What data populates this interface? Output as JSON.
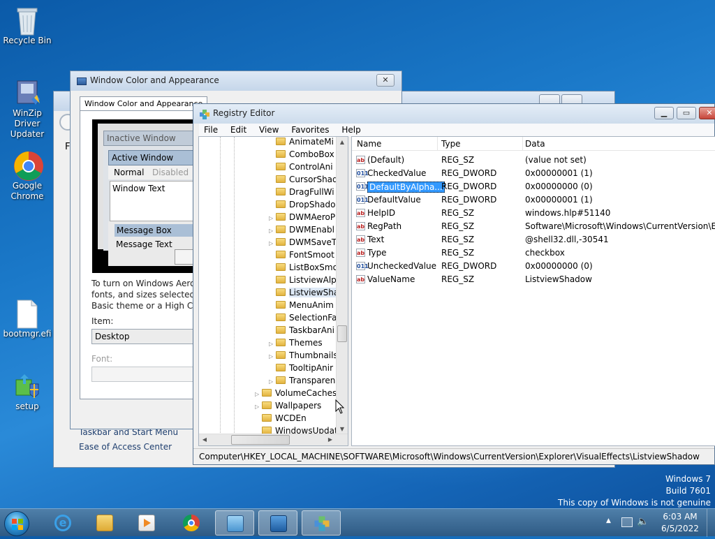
{
  "desktop": {
    "icons": [
      {
        "label": "Recycle Bin"
      },
      {
        "label": "WinZip Driver Updater"
      },
      {
        "label": "Google Chrome"
      },
      {
        "label": "bootmgr.efi"
      },
      {
        "label": "setup"
      }
    ],
    "watermark": {
      "line1": "Windows 7",
      "line2": "Build 7601",
      "line3": "This copy of Windows is not genuine"
    }
  },
  "bg_window": {
    "items": [
      "Taskbar and Start Menu",
      "Ease of Access Center"
    ],
    "partial": "F"
  },
  "appearance": {
    "title": "Window Color and Appearance",
    "tab": "Window Color and Appearance",
    "preview": {
      "inactive": "Inactive Window",
      "active": "Active Window",
      "normal": "Normal",
      "disabled": "Disabled",
      "window_text": "Window Text",
      "message_box": "Message Box",
      "message_text": "Message Text"
    },
    "help_lines": [
      "To turn on Windows Aero, s",
      "fonts, and sizes selected her",
      "Basic theme or a High Cont"
    ],
    "item_label": "Item:",
    "item_value": "Desktop",
    "font_label": "Font:"
  },
  "regedit": {
    "title": "Registry Editor",
    "menu": [
      "File",
      "Edit",
      "View",
      "Favorites",
      "Help"
    ],
    "tree": [
      {
        "label": "AnimateMi",
        "level": 2,
        "exp": false
      },
      {
        "label": "ComboBox",
        "level": 2,
        "exp": false
      },
      {
        "label": "ControlAni",
        "level": 2,
        "exp": false
      },
      {
        "label": "CursorShad",
        "level": 2,
        "exp": false
      },
      {
        "label": "DragFullWi",
        "level": 2,
        "exp": false
      },
      {
        "label": "DropShado",
        "level": 2,
        "exp": false
      },
      {
        "label": "DWMAeroP",
        "level": 2,
        "exp": true
      },
      {
        "label": "DWMEnabl",
        "level": 2,
        "exp": true
      },
      {
        "label": "DWMSaveT",
        "level": 2,
        "exp": true
      },
      {
        "label": "FontSmoot",
        "level": 2,
        "exp": false
      },
      {
        "label": "ListBoxSmo",
        "level": 2,
        "exp": false
      },
      {
        "label": "ListviewAlp",
        "level": 2,
        "exp": false
      },
      {
        "label": "ListviewSha",
        "level": 2,
        "exp": false,
        "selected": true
      },
      {
        "label": "MenuAnim",
        "level": 2,
        "exp": false
      },
      {
        "label": "SelectionFa",
        "level": 2,
        "exp": false
      },
      {
        "label": "TaskbarAni",
        "level": 2,
        "exp": false
      },
      {
        "label": "Themes",
        "level": 2,
        "exp": true
      },
      {
        "label": "Thumbnails",
        "level": 2,
        "exp": true
      },
      {
        "label": "TooltipAnir",
        "level": 2,
        "exp": false
      },
      {
        "label": "Transparen",
        "level": 2,
        "exp": true
      },
      {
        "label": "VolumeCaches",
        "level": 1,
        "exp": true
      },
      {
        "label": "Wallpapers",
        "level": 1,
        "exp": true
      },
      {
        "label": "WCDEn",
        "level": 1,
        "exp": false
      },
      {
        "label": "WindowsUpdat",
        "level": 1,
        "exp": false
      }
    ],
    "columns": {
      "name": "Name",
      "type": "Type",
      "data": "Data"
    },
    "values": [
      {
        "name": "(Default)",
        "type": "REG_SZ",
        "data": "(value not set)",
        "kind": "sz"
      },
      {
        "name": "CheckedValue",
        "type": "REG_DWORD",
        "data": "0x00000001 (1)",
        "kind": "bin"
      },
      {
        "name": "DefaultByAlpha...",
        "type": "REG_DWORD",
        "data": "0x00000000 (0)",
        "kind": "bin",
        "selected": true
      },
      {
        "name": "DefaultValue",
        "type": "REG_DWORD",
        "data": "0x00000001 (1)",
        "kind": "bin"
      },
      {
        "name": "HelpID",
        "type": "REG_SZ",
        "data": "windows.hlp#51140",
        "kind": "sz"
      },
      {
        "name": "RegPath",
        "type": "REG_SZ",
        "data": "Software\\Microsoft\\Windows\\CurrentVersion\\Expl...",
        "kind": "sz"
      },
      {
        "name": "Text",
        "type": "REG_SZ",
        "data": "@shell32.dll,-30541",
        "kind": "sz"
      },
      {
        "name": "Type",
        "type": "REG_SZ",
        "data": "checkbox",
        "kind": "sz"
      },
      {
        "name": "UncheckedValue",
        "type": "REG_DWORD",
        "data": "0x00000000 (0)",
        "kind": "bin"
      },
      {
        "name": "ValueName",
        "type": "REG_SZ",
        "data": "ListviewShadow",
        "kind": "sz"
      }
    ],
    "status_path": "Computer\\HKEY_LOCAL_MACHINE\\SOFTWARE\\Microsoft\\Windows\\CurrentVersion\\Explorer\\VisualEffects\\ListviewShadow"
  },
  "taskbar": {
    "buttons": [
      {
        "name": "internet-explorer"
      },
      {
        "name": "file-explorer"
      },
      {
        "name": "media-player"
      },
      {
        "name": "chrome"
      },
      {
        "name": "control-panel"
      },
      {
        "name": "appearance-window"
      },
      {
        "name": "registry-editor"
      }
    ],
    "clock": {
      "time": "6:03 AM",
      "date": "6/5/2022"
    }
  }
}
